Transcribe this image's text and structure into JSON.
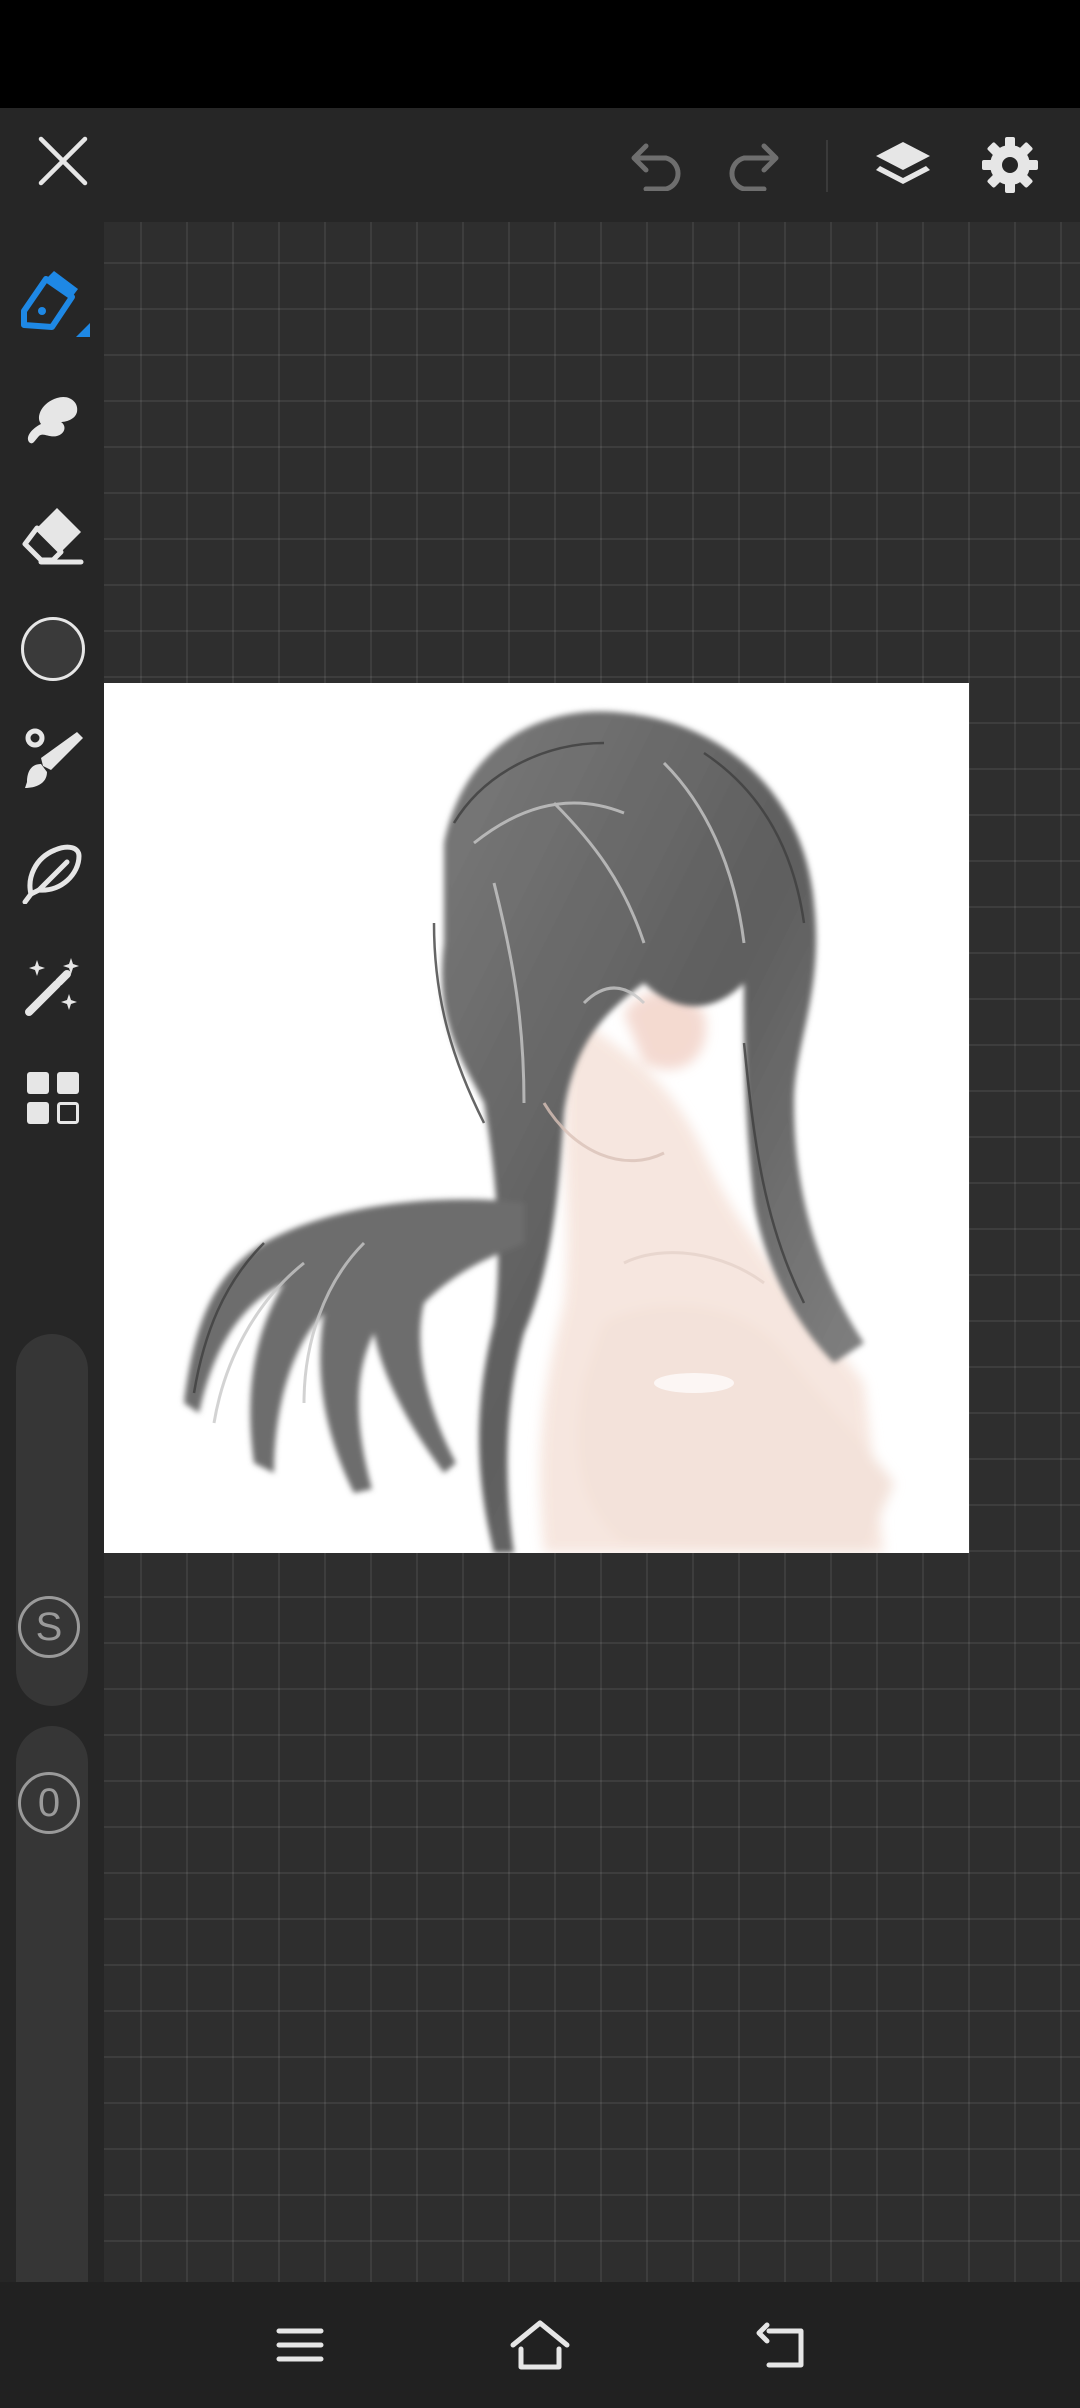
{
  "app": {
    "accent_color": "#1e88e5",
    "icon_color": "#e6e6e6",
    "disabled_icon_color": "#6e6e6e"
  },
  "topbar": {
    "icons": [
      "close-icon",
      "undo-icon",
      "redo-icon",
      "layers-icon",
      "settings-icon"
    ]
  },
  "tools": [
    {
      "name": "pen",
      "icon": "pen-icon",
      "active": true
    },
    {
      "name": "smudge",
      "icon": "smudge-icon"
    },
    {
      "name": "eraser",
      "icon": "eraser-icon"
    },
    {
      "name": "color",
      "icon": "color-swatch",
      "value": "#3a3a3a"
    },
    {
      "name": "brush",
      "icon": "brush-icon"
    },
    {
      "name": "lasso",
      "icon": "lasso-icon"
    },
    {
      "name": "magic",
      "icon": "magic-wand-icon"
    },
    {
      "name": "more",
      "icon": "grid-icon"
    }
  ],
  "sliders": {
    "size_label": "S",
    "opacity_label": "0"
  },
  "navbar": {
    "icons": [
      "menu-icon",
      "home-icon",
      "back-icon"
    ]
  }
}
